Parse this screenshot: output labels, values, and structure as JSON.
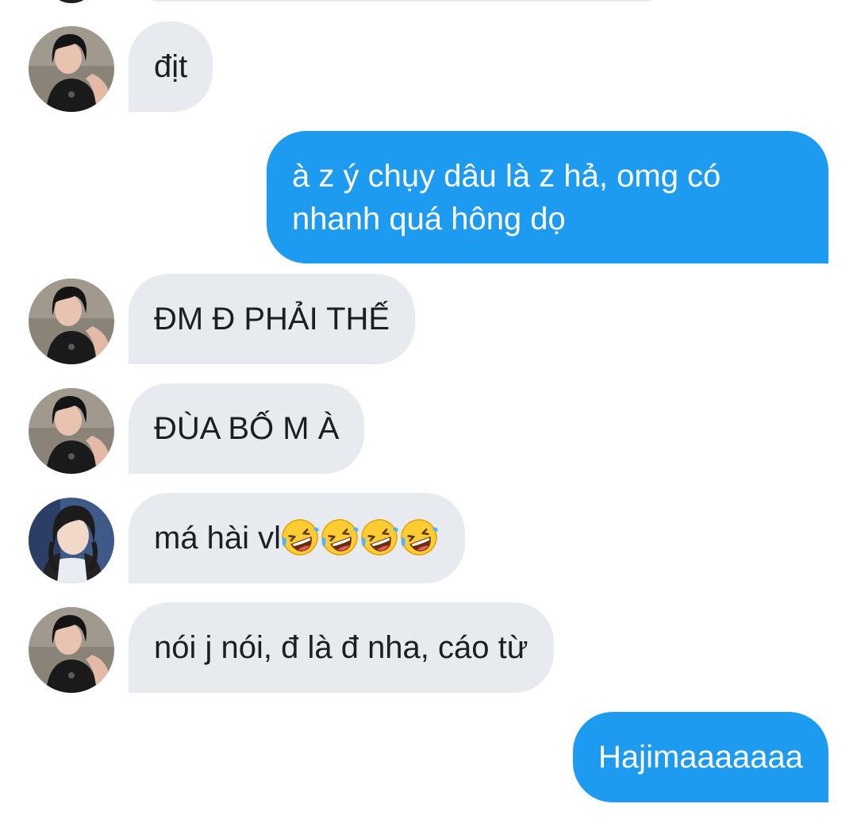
{
  "messages": [
    {
      "sender": "friend1",
      "text": "địt"
    },
    {
      "sender": "me",
      "lines": [
        "à z ý chụy dâu là z hả, omg có",
        "nhanh quá hông dọ"
      ]
    },
    {
      "sender": "friend1",
      "text": "ĐM Đ PHẢI THẾ"
    },
    {
      "sender": "friend1",
      "text": "ĐÙA BỐ M À"
    },
    {
      "sender": "friend2",
      "text": "má hài vl",
      "emoji": "rolling-on-the-floor-laughing-icon",
      "emoji_count": 4
    },
    {
      "sender": "friend1",
      "text": "nói j nói, đ là đ nha, cáo từ"
    },
    {
      "sender": "me",
      "text": "Hajimaaaaaaa"
    }
  ],
  "colors": {
    "incoming_bubble": "#e7ebf0",
    "outgoing_bubble": "#1d9bf0",
    "incoming_text": "#1c1e21",
    "outgoing_text": "#ffffff"
  }
}
